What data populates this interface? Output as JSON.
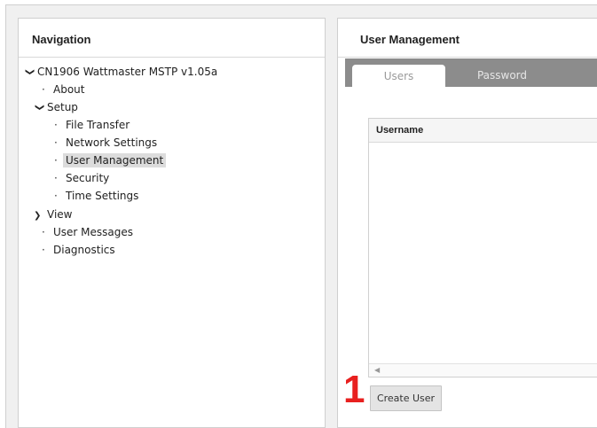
{
  "navigation": {
    "title": "Navigation",
    "tree": [
      {
        "label": "CN1906 Wattmaster MSTP v1.05a",
        "level": 0,
        "marker": "expanded"
      },
      {
        "label": "About",
        "level": 1,
        "marker": "bullet"
      },
      {
        "label": "Setup",
        "level": 1,
        "marker": "expanded"
      },
      {
        "label": "File Transfer",
        "level": 2,
        "marker": "bullet"
      },
      {
        "label": "Network Settings",
        "level": 2,
        "marker": "bullet"
      },
      {
        "label": "User Management",
        "level": 2,
        "marker": "bullet",
        "selected": true
      },
      {
        "label": "Security",
        "level": 2,
        "marker": "bullet"
      },
      {
        "label": "Time Settings",
        "level": 2,
        "marker": "bullet"
      },
      {
        "label": "View",
        "level": 1,
        "marker": "collapsed"
      },
      {
        "label": "User Messages",
        "level": 1,
        "marker": "bullet"
      },
      {
        "label": "Diagnostics",
        "level": 1,
        "marker": "bullet"
      }
    ]
  },
  "user_management": {
    "title": "User Management",
    "tabs": [
      {
        "label": "Users",
        "active": true
      },
      {
        "label": "Password",
        "active": false
      }
    ],
    "table": {
      "columns": [
        "Username"
      ],
      "rows": []
    },
    "create_button_label": "Create User"
  },
  "annotation": {
    "step_number": "1",
    "color": "#e8201f"
  },
  "colors": {
    "tab_bar": "#8c8c8c",
    "selected_item": "#dcdcdc"
  }
}
